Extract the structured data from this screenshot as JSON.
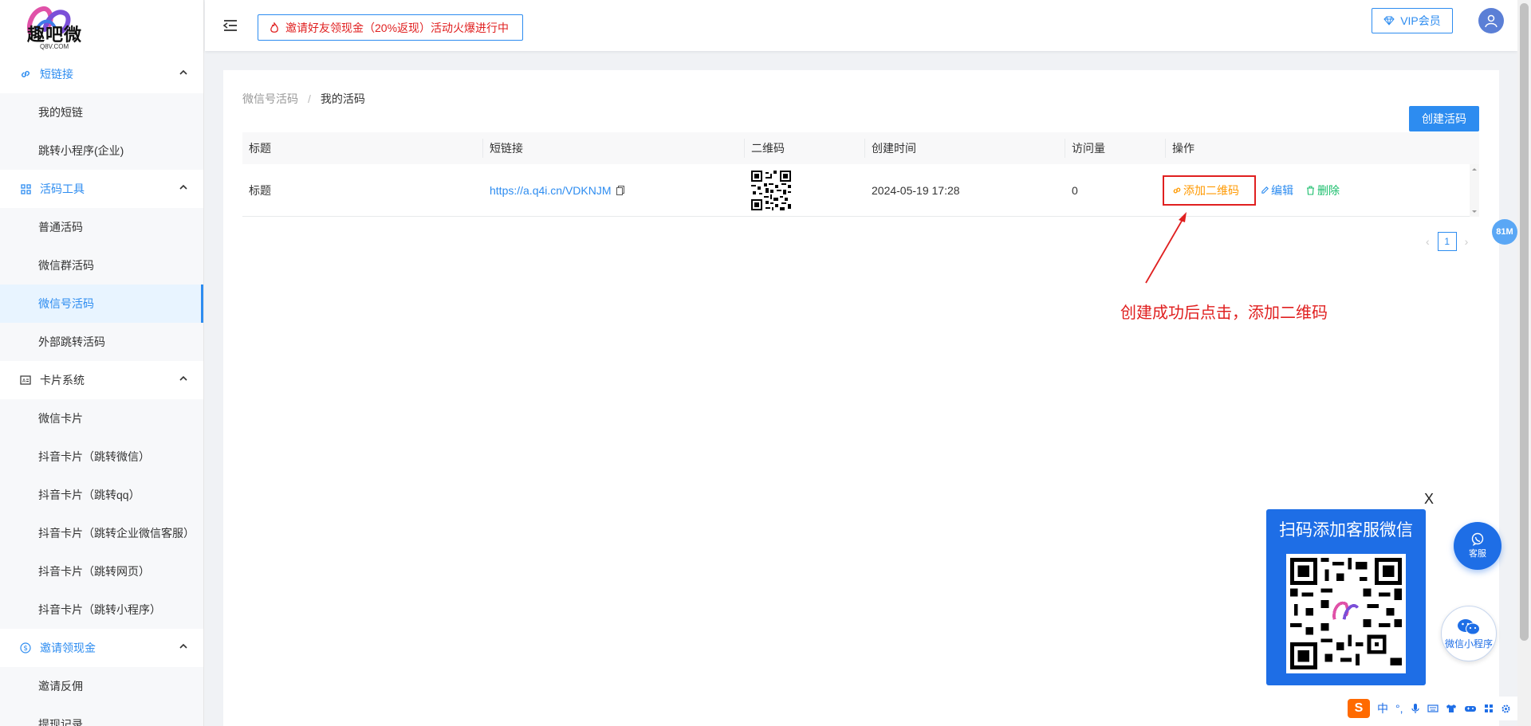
{
  "brand": {
    "name": "趣吧微",
    "sub": "Q8V.COM"
  },
  "sidebar": {
    "groups": [
      {
        "label": "短链接",
        "icon": "link-icon",
        "items": [
          "我的短链",
          "跳转小程序(企业)"
        ]
      },
      {
        "label": "活码工具",
        "icon": "grid-icon",
        "items": [
          "普通活码",
          "微信群活码",
          "微信号活码",
          "外部跳转活码"
        ]
      },
      {
        "label": "卡片系统",
        "icon": "card-icon",
        "items": [
          "微信卡片",
          "抖音卡片（跳转微信）",
          "抖音卡片（跳转qq）",
          "抖音卡片（跳转企业微信客服）",
          "抖音卡片（跳转网页）",
          "抖音卡片（跳转小程序）"
        ]
      },
      {
        "label": "邀请领现金",
        "icon": "dollar-icon",
        "items": [
          "邀请反佣",
          "提现记录"
        ]
      }
    ],
    "active_item": "微信号活码"
  },
  "topbar": {
    "promo": "邀请好友领现金（20%返现）活动火爆进行中",
    "vip": "VIP会员"
  },
  "breadcrumb": {
    "parent": "微信号活码",
    "separator": "/",
    "current": "我的活码"
  },
  "create_button": "创建活码",
  "table": {
    "headers": [
      "标题",
      "短链接",
      "二维码",
      "创建时间",
      "访问量",
      "操作"
    ],
    "rows": [
      {
        "title": "标题",
        "short_link": "https://a.q4i.cn/VDKNJM",
        "created": "2024-05-19 17:28",
        "visits": "0",
        "actions": {
          "add_qr": "添加二维码",
          "edit": "编辑",
          "delete": "删除"
        }
      }
    ]
  },
  "pagination": {
    "current_page": "1"
  },
  "annotation": "创建成功后点击，添加二维码",
  "memory_badge": "81M",
  "cs_popup": {
    "title": "扫码添加客服微信",
    "close": "X"
  },
  "float_buttons": {
    "service": "客服",
    "mini_program": "微信小程序"
  },
  "ime": {
    "lang": "中",
    "punct": "°,"
  },
  "colors": {
    "primary": "#2d8cf0",
    "warning": "#ff9900",
    "danger": "#e02020",
    "success": "#19be6b"
  }
}
